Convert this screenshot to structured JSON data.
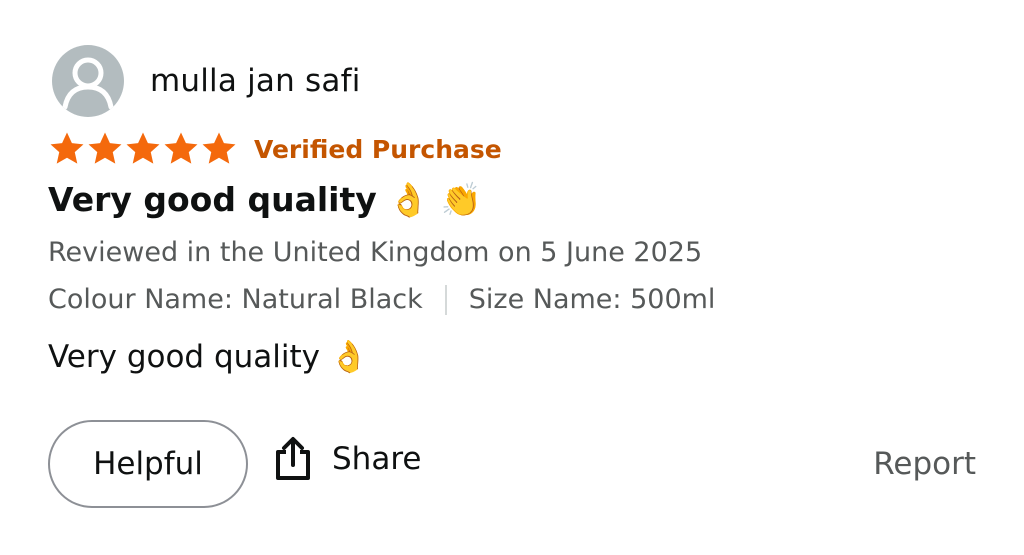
{
  "reviewer": {
    "name": "mulla jan safi",
    "avatar_icon": "person-silhouette-icon"
  },
  "rating": {
    "stars": 5,
    "max_stars": 5,
    "star_color": "#f4690c",
    "badge": "Verified Purchase",
    "badge_color": "#c45500"
  },
  "review": {
    "title": "Very good quality 👌 👏",
    "meta": "Reviewed in the United Kingdom on 5 June 2025",
    "variant_colour": "Colour Name: Natural Black",
    "variant_size": "Size Name: 500ml",
    "body": "Very good quality 👌"
  },
  "actions": {
    "helpful_label": "Helpful",
    "share_label": "Share",
    "share_icon": "share-upload-icon",
    "report_label": "Report"
  }
}
